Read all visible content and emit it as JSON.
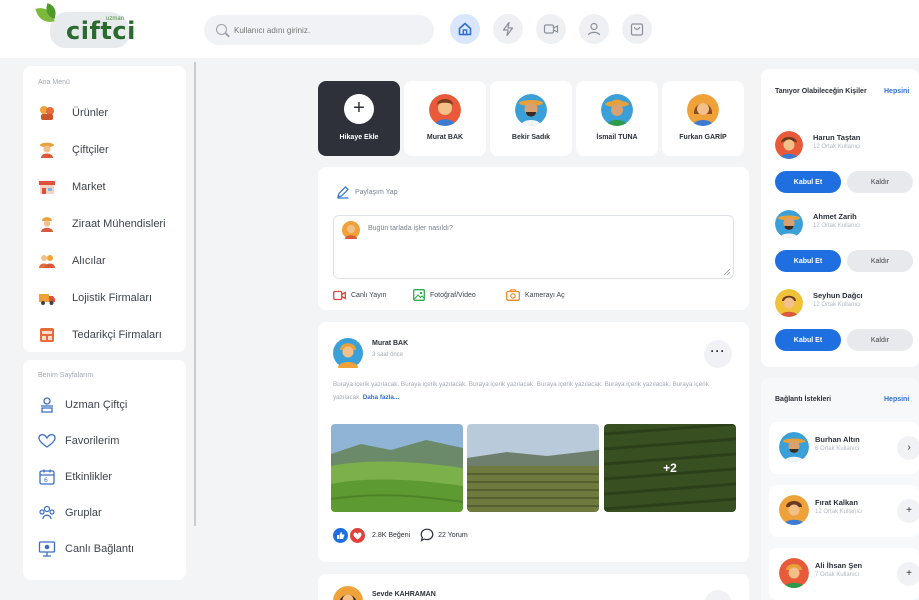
{
  "brand": {
    "name": "ciftci",
    "sub": "uzman"
  },
  "search": {
    "placeholder": "Kullanıcı adını giriniz."
  },
  "nav_icons": [
    "home-icon",
    "lightning-icon",
    "video-icon",
    "user-icon",
    "shopping-bag-icon"
  ],
  "sidebar": {
    "main_title": "Ana Menü",
    "main_items": [
      {
        "label": "Ürünler",
        "icon": "products-icon"
      },
      {
        "label": "Çiftçiler",
        "icon": "farmer-icon"
      },
      {
        "label": "Market",
        "icon": "market-icon"
      },
      {
        "label": "Ziraat Mühendisleri",
        "icon": "engineer-icon"
      },
      {
        "label": "Alıcılar",
        "icon": "buyers-icon"
      },
      {
        "label": "Lojistik Firmaları",
        "icon": "truck-icon"
      },
      {
        "label": "Tedarikçi Firmaları",
        "icon": "supplier-icon"
      }
    ],
    "pages_title": "Benim Sayfalarım",
    "page_items": [
      {
        "label": "Uzman Çiftçi",
        "icon": "expert-icon"
      },
      {
        "label": "Favorilerim",
        "icon": "heart-icon"
      },
      {
        "label": "Etkinlikler",
        "icon": "calendar-icon"
      },
      {
        "label": "Gruplar",
        "icon": "group-icon"
      },
      {
        "label": "Canlı Bağlantı",
        "icon": "live-icon"
      }
    ]
  },
  "stories": [
    {
      "name": "Hikaye Ekle",
      "type": "add"
    },
    {
      "name": "Murat BAK"
    },
    {
      "name": "Bekir Sadık"
    },
    {
      "name": "İsmail TUNA"
    },
    {
      "name": "Furkan GARİP"
    }
  ],
  "composer": {
    "title": "Paylaşım Yap",
    "placeholder": "Bugün tarlada işler nasıldı?",
    "actions": [
      {
        "label": "Canlı Yayın",
        "icon": "live-video-icon",
        "color": "#e0413a"
      },
      {
        "label": "Fotoğraf/Video",
        "icon": "image-icon",
        "color": "#2fa84f"
      },
      {
        "label": "Kamerayı Aç",
        "icon": "camera-icon",
        "color": "#f08a24"
      }
    ]
  },
  "post": {
    "author": "Murat BAK",
    "time": "3 saat önce",
    "body": "Buraya içerik yazılacak. Buraya içerik yazılacak. Buraya içerik yazılacak. Buraya içerik yazılacak. Buraya içerik yazılacak. Buraya içerik yazılacak.",
    "read_more": "Daha fazla...",
    "more_photos": "+2",
    "likes": "2.8K Beğeni",
    "comments": "22 Yorum"
  },
  "post2": {
    "author": "Sevde KAHRAMAN"
  },
  "suggestions": {
    "title": "Tanıyor Olabileceğin Kişiler",
    "all": "Hepsini",
    "accept": "Kabul Et",
    "remove": "Kaldır",
    "people": [
      {
        "name": "Harun Taştan",
        "mutual": "12 Ortak Kullanıcı"
      },
      {
        "name": "Ahmet Zarih",
        "mutual": "12 Ortak Kullanıcı"
      },
      {
        "name": "Seyhun Dağcı",
        "mutual": "12 Ortak Kullanıcı"
      }
    ]
  },
  "requests": {
    "title": "Bağlantı İstekleri",
    "all": "Hepsini",
    "people": [
      {
        "name": "Burhan Altın",
        "mutual": "6 Ortak Kullanıcı",
        "action": "›"
      },
      {
        "name": "Fırat Kalkan",
        "mutual": "12 Ortak Kullanıcı",
        "action": "+"
      },
      {
        "name": "Ali İhsan Şen",
        "mutual": "7 Ortak Kullanıcı",
        "action": "+"
      }
    ]
  },
  "colors": {
    "accent": "#1f6fe0",
    "dark_story": "#2e3139",
    "page_bg": "#f3f4f6"
  }
}
